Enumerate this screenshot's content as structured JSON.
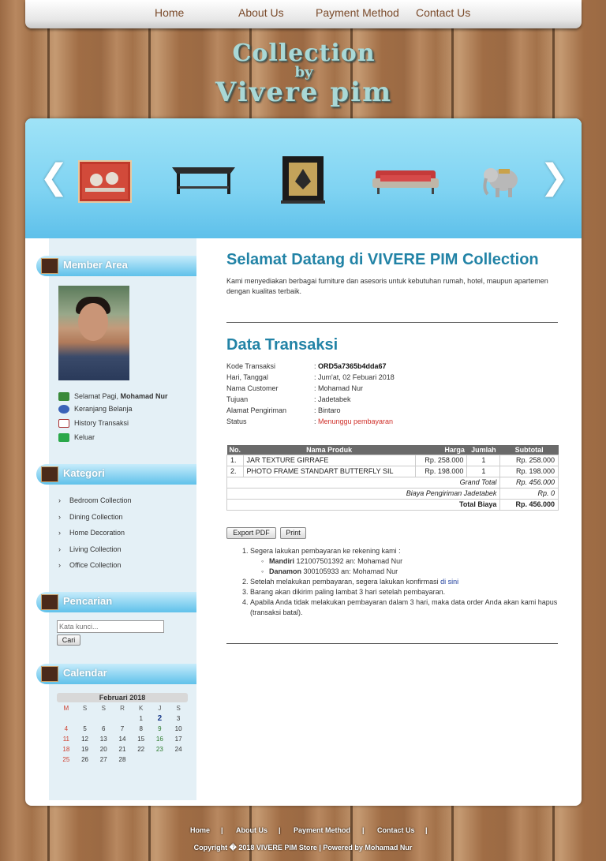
{
  "nav": {
    "home": "Home",
    "about": "About Us",
    "payment": "Payment Method",
    "contact": "Contact Us"
  },
  "logo": {
    "line1": "Collection",
    "line2": "by",
    "line3": "Vivere pim"
  },
  "sidebar": {
    "member_title": "Member Area",
    "greeting_prefix": "Selamat Pagi, ",
    "greeting_name": "Mohamad Nur",
    "cart": "Keranjang Belanja",
    "history": "History Transaksi",
    "logout": "Keluar",
    "category_title": "Kategori",
    "categories": [
      "Bedroom Collection",
      "Dining Collection",
      "Home Decoration",
      "Living Collection",
      "Office Collection"
    ],
    "search_title": "Pencarian",
    "search_placeholder": "Kata kunci...",
    "search_button": "Cari",
    "calendar_title": "Calendar",
    "calendar_month": "Februari 2018",
    "calendar_days": [
      "M",
      "S",
      "S",
      "R",
      "K",
      "J",
      "S"
    ],
    "calendar_weeks": [
      [
        "",
        "",
        "",
        "",
        "1",
        "2",
        "3"
      ],
      [
        "4",
        "5",
        "6",
        "7",
        "8",
        "9",
        "10"
      ],
      [
        "11",
        "12",
        "13",
        "14",
        "15",
        "16",
        "17"
      ],
      [
        "18",
        "19",
        "20",
        "21",
        "22",
        "23",
        "24"
      ],
      [
        "25",
        "26",
        "27",
        "28",
        "",
        "",
        ""
      ]
    ]
  },
  "main": {
    "welcome_title": "Selamat Datang di VIVERE PIM Collection",
    "welcome_text": "Kami menyediakan berbagai furniture dan asesoris untuk kebutuhan rumah, hotel, maupun apartemen dengan kualitas terbaik.",
    "transaction_title": "Data Transaksi",
    "details": [
      {
        "label": "Kode Transaksi",
        "value": "ORD5a7365b4dda67"
      },
      {
        "label": "Hari, Tanggal",
        "value": "Jum'at, 02 Febuari 2018"
      },
      {
        "label": "Nama Customer",
        "value": "Mohamad Nur"
      },
      {
        "label": "Tujuan",
        "value": "Jadetabek"
      },
      {
        "label": "Alamat Pengiriman",
        "value": "Bintaro"
      },
      {
        "label": "Status",
        "value": "Menunggu pembayaran"
      }
    ],
    "table": {
      "headers": [
        "No.",
        "Nama Produk",
        "Harga",
        "Jumlah",
        "Subtotal"
      ],
      "rows": [
        [
          "1.",
          "JAR TEXTURE GIRRAFE",
          "Rp. 258.000",
          "1",
          "Rp. 258.000"
        ],
        [
          "2.",
          "PHOTO FRAME STANDART BUTTERFLY SIL",
          "Rp. 198.000",
          "1",
          "Rp. 198.000"
        ]
      ],
      "grand_total_label": "Grand Total",
      "grand_total": "Rp. 456.000",
      "shipping_label": "Biaya Pengiriman Jadetabek",
      "shipping": "Rp. 0",
      "total_label": "Total Biaya",
      "total": "Rp. 456.000"
    },
    "export_button": "Export PDF",
    "print_button": "Print",
    "instructions": {
      "item1": "Segera lakukan pembayaran ke rekening kami :",
      "bank1_name": "Mandiri",
      "bank1_detail": " 121007501392 an: Mohamad Nur",
      "bank2_name": "Danamon",
      "bank2_detail": " 300105933 an: Mohamad Nur",
      "item2_text": "Setelah melakukan pembayaran, segera lakukan konfirmasi ",
      "item2_link": "di sini",
      "item3": "Barang akan dikirim paling lambat 3 hari setelah pembayaran.",
      "item4": "Apabila Anda tidak melakukan pembayaran dalam 3 hari, maka data order Anda akan kami hapus (transaksi batal)."
    }
  },
  "footer": {
    "home": "Home",
    "about": "About Us",
    "payment": "Payment Method",
    "contact": "Contact Us",
    "sep": "|",
    "copyright": "Copyright � 2018 VIVERE PIM Store | Powered by Mohamad Nur"
  }
}
